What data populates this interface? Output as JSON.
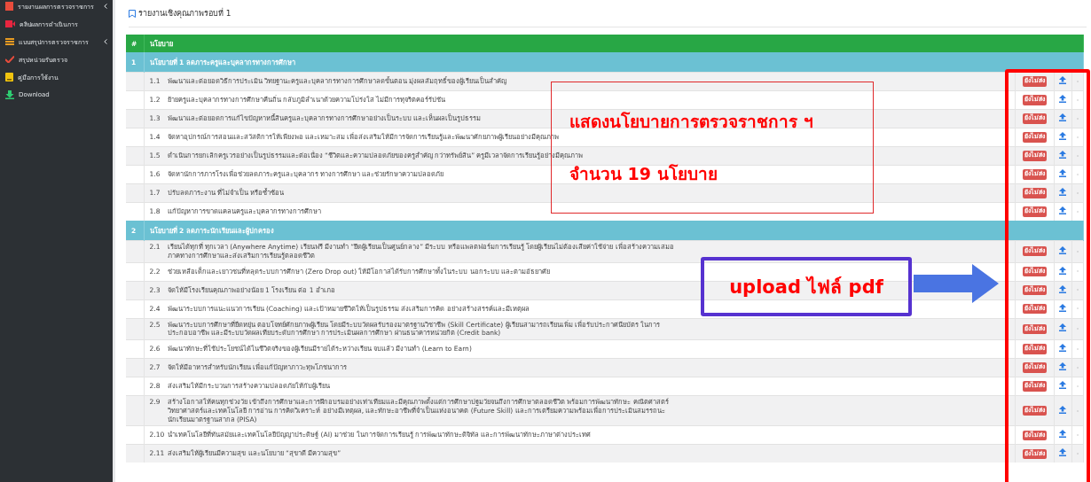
{
  "sidebar": {
    "items": [
      {
        "label": "รายงานผลการตรวจราชการ",
        "has_submenu": true
      },
      {
        "label": "คลิปผลการดำเนินการ",
        "has_submenu": false
      },
      {
        "label": "แบบสรุปการตรวจราชการ",
        "has_submenu": true
      },
      {
        "label": "สรุปหน่วยรับตรวจ",
        "has_submenu": false
      },
      {
        "label": "คู่มือการใช้งาน",
        "has_submenu": false
      },
      {
        "label": "Download",
        "has_submenu": false
      }
    ]
  },
  "page_title": "รายงานเชิงคุณภาพรอบที่ 1",
  "table": {
    "columns": [
      "#",
      "นโยบาย"
    ],
    "groups": [
      {
        "number": "1",
        "title": "นโยบายที่ 1 ลดภาระครูและบุคลากรทางการศึกษา",
        "items": [
          {
            "number": "1.1",
            "text": "พัฒนาและต่อยอดวิธีการประเมิน วิทยฐานะครูและบุคลากรทางการศึกษาลดขั้นตอน มุ่งผลสัมฤทธิ์ของผู้เรียนเป็นสำคัญ",
            "status": "ยังไม่ส่ง",
            "file": "-"
          },
          {
            "number": "1.2",
            "text": "ย้ายครูและบุคลากรทางการศึกษาคืนถิ่น กลับภูมิลำเนาด้วยความโปร่งใส ไม่มีการทุจริตคอร์รัปชัน",
            "status": "ยังไม่ส่ง",
            "file": "-"
          },
          {
            "number": "1.3",
            "text": "พัฒนาและต่อยอดการแก้ไขปัญหาหนี้สินครูและบุคลากรทางการศึกษาอย่างเป็นระบบ และเห็นผลเป็นรูปธรรม",
            "status": "ยังไม่ส่ง",
            "file": "-"
          },
          {
            "number": "1.4",
            "text": "จัดหาอุปกรณ์การสอนและสวัสดิการให้เพียงพอ และเหมาะสม เพื่อส่งเสริมให้มีการจัดการเรียนรู้และพัฒนาศักยภาพผู้เรียนอย่างมีคุณภาพ",
            "status": "ยังไม่ส่ง",
            "file": "-"
          },
          {
            "number": "1.5",
            "text": "ดำเนินการยกเลิกครูเวรอย่างเป็นรูปธรรมและต่อเนื่อง “ชีวิตและความปลอดภัยของครูสำคัญ กว่าทรัพย์สิน” ครูมีเวลาจัดการเรียนรู้อย่างมีคุณภาพ",
            "status": "ยังไม่ส่ง",
            "file": "-"
          },
          {
            "number": "1.6",
            "text": "จัดหานักการภารโรงเพื่อช่วยลดภาระครูและบุคลากร ทางการศึกษา และช่วยรักษาความปลอดภัย",
            "status": "ยังไม่ส่ง",
            "file": "-"
          },
          {
            "number": "1.7",
            "text": "ปรับลดภาระงาน ที่ไม่จำเป็น หรือซ้ำซ้อน",
            "status": "ยังไม่ส่ง",
            "file": "-"
          },
          {
            "number": "1.8",
            "text": "แก้ปัญหาการขาดแคลนครูและบุคลากรทางการศึกษา",
            "status": "ยังไม่ส่ง",
            "file": "-"
          }
        ]
      },
      {
        "number": "2",
        "title": "นโยบายที่ 2 ลดภาระนักเรียนและผู้ปกครอง",
        "items": [
          {
            "number": "2.1",
            "text": "เรียนได้ทุกที่ ทุกเวลา (Anywhere Anytime) เรียนฟรี มีงานทำ “ยึดผู้เรียนเป็นศูนย์กลาง” มีระบบ หรือแพลตฟอร์มการเรียนรู้ โดยผู้เรียนไม่ต้องเสียค่าใช้จ่าย เพื่อสร้างความเสมอภาคทางการศึกษาและส่งเสริมการเรียนรู้ตลอดชีวิต",
            "status": "ยังไม่ส่ง",
            "file": "-"
          },
          {
            "number": "2.2",
            "text": "ช่วยเหลือเด็กและเยาวชนที่หลุดระบบการศึกษา (Zero Drop out) ให้มีโอกาสได้รับการศึกษาทั้งในระบบ นอกระบบ และตามอัธยาศัย",
            "status": "ยังไม่ส่ง",
            "file": "-"
          },
          {
            "number": "2.3",
            "text": "จัดให้มีโรงเรียนคุณภาพอย่างน้อย 1 โรงเรียน ต่อ 1 อำเภอ",
            "status": "ยังไม่ส่ง",
            "file": "-"
          },
          {
            "number": "2.4",
            "text": "พัฒนาระบบการแนะแนวการเรียน (Coaching) และเป้าหมายชีวิตให้เป็นรูปธรรม ส่งเสริมการคิด อย่างสร้างสรรค์และมีเหตุผล",
            "status": "ยังไม่ส่ง",
            "file": "-"
          },
          {
            "number": "2.5",
            "text": "พัฒนาระบบการศึกษาที่ยืดหยุ่น ตอบโจทย์ศักยภาพผู้เรียน โดยมีระบบวัดผลรับรองมาตรฐานวิชาชีพ (Skill Certificate) ผู้เรียนสามารถเรียนเพิ่ม เพื่อรับประกาศนียบัตร ในการประกอบอาชีพ และมีระบบวัดผลเทียบระดับการศึกษา การประเมินผลการศึกษา ผ่านธนาคารหน่วยกิต (Credit bank)",
            "status": "ยังไม่ส่ง",
            "file": "-"
          },
          {
            "number": "2.6",
            "text": "พัฒนาทักษะที่ใช้ประโยชน์ได้ในชีวิตจริงของผู้เรียนมีรายได้ระหว่างเรียน จบแล้ว มีงานทำ (Learn to Earn)",
            "status": "ยังไม่ส่ง",
            "file": "-"
          },
          {
            "number": "2.7",
            "text": "จัดให้มีอาหารสำหรับนักเรียน เพื่อแก้ปัญหาภาวะทุพโภชนาการ",
            "status": "ยังไม่ส่ง",
            "file": "-"
          },
          {
            "number": "2.8",
            "text": "ส่งเสริมให้มีกระบวนการสร้างความปลอดภัยให้กับผู้เรียน",
            "status": "ยังไม่ส่ง",
            "file": "-"
          },
          {
            "number": "2.9",
            "text": "สร้างโอกาสให้คนทุกช่วงวัย เข้าถึงการศึกษาและการฝึกอบรมอย่างเท่าเทียมและมีคุณภาพตั้งแต่การศึกษาปฐมวัยจนถึงการศึกษาตลอดชีวิต พร้อมการพัฒนาทักษะ คณิตศาสตร์ วิทยาศาสตร์และเทคโนโลยี การอ่าน การคิดวิเคราะห์ อย่างมีเหตุผล, และทักษะอาชีพที่จำเป็นแห่งอนาคต (Future Skill) และการเตรียมความพร้อมเพื่อการประเมินสมรรถนะนักเรียนมาตรฐานสากล (PISA)",
            "status": "ยังไม่ส่ง",
            "file": "-"
          },
          {
            "number": "2.10",
            "text": "นำเทคโนโลยีที่ทันสมัยและเทคโนโลยีปัญญาประดิษฐ์ (AI) มาช่วย ในการจัดการเรียนรู้ การพัฒนาทักษะดิจิทัล และการพัฒนาทักษะภาษาต่างประเทศ",
            "status": "ยังไม่ส่ง",
            "file": "-"
          },
          {
            "number": "2.11",
            "text": "ส่งเสริมให้ผู้เรียนมีความสุข และนโยบาย “สุขาดี มีความสุข”",
            "status": "ยังไม่ส่ง",
            "file": "-"
          }
        ]
      }
    ]
  },
  "annotations": {
    "policy_note": [
      "แสดงนโยบายการตรวจราชการ ฯ",
      "จำนวน 19 นโยบาย"
    ],
    "upload_note": "upload ไฟล์ pdf"
  }
}
